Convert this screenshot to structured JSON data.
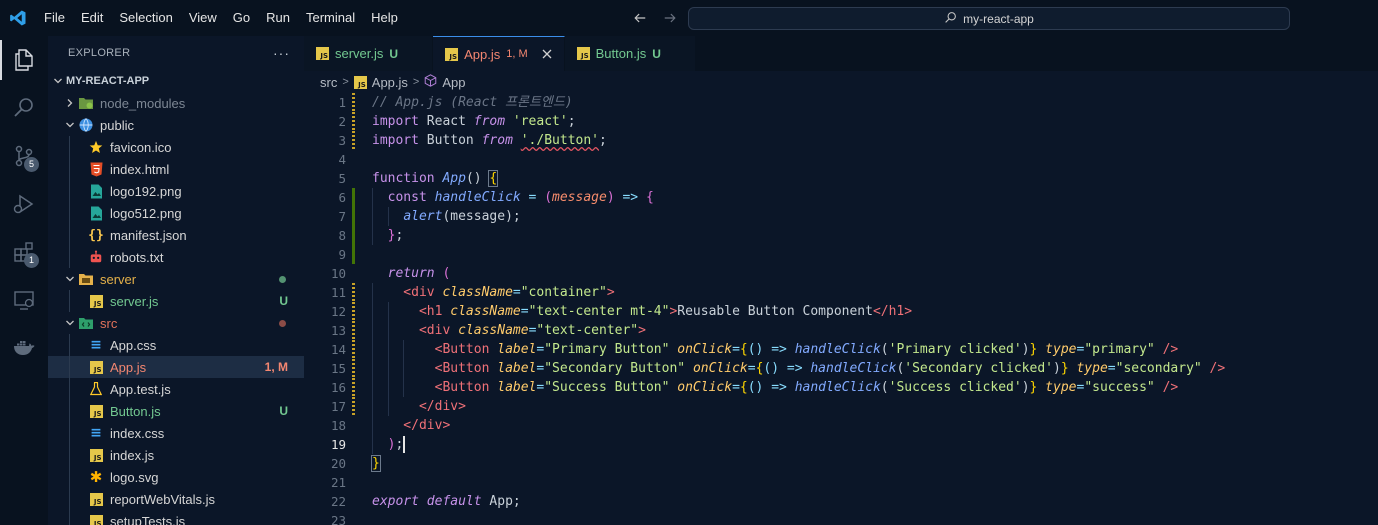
{
  "menu": [
    "File",
    "Edit",
    "Selection",
    "View",
    "Go",
    "Run",
    "Terminal",
    "Help"
  ],
  "search": {
    "label": "my-react-app"
  },
  "activity": {
    "scm_badge": "5",
    "extensions_badge": "1"
  },
  "explorer": {
    "title": "EXPLORER",
    "more": "···",
    "project": "MY-REACT-APP",
    "items": [
      {
        "label": "node_modules",
        "status": ""
      },
      {
        "label": "public",
        "status": ""
      },
      {
        "label": "favicon.ico",
        "status": ""
      },
      {
        "label": "index.html",
        "status": ""
      },
      {
        "label": "logo192.png",
        "status": ""
      },
      {
        "label": "logo512.png",
        "status": ""
      },
      {
        "label": "manifest.json",
        "status": ""
      },
      {
        "label": "robots.txt",
        "status": ""
      },
      {
        "label": "server",
        "status": ""
      },
      {
        "label": "server.js",
        "status": "U"
      },
      {
        "label": "src",
        "status": ""
      },
      {
        "label": "App.css",
        "status": ""
      },
      {
        "label": "App.js",
        "status": "1, M"
      },
      {
        "label": "App.test.js",
        "status": ""
      },
      {
        "label": "Button.js",
        "status": "U"
      },
      {
        "label": "index.css",
        "status": ""
      },
      {
        "label": "index.js",
        "status": ""
      },
      {
        "label": "logo.svg",
        "status": ""
      },
      {
        "label": "reportWebVitals.js",
        "status": ""
      },
      {
        "label": "setupTests.js",
        "status": ""
      }
    ]
  },
  "tabs": [
    {
      "label": "server.js",
      "status": "U"
    },
    {
      "label": "App.js",
      "status": "1, M"
    },
    {
      "label": "Button.js",
      "status": "U"
    }
  ],
  "breadcrumb": [
    "src",
    "App.js",
    "App"
  ],
  "editor": {
    "line_numbers": [
      "1",
      "2",
      "3",
      "4",
      "5",
      "6",
      "7",
      "8",
      "9",
      "10",
      "11",
      "12",
      "13",
      "14",
      "15",
      "16",
      "17",
      "18",
      "19",
      "20",
      "21",
      "22",
      "23"
    ],
    "current_line": 19,
    "lines": [
      [
        [
          "// App.js (React 프론트엔드)",
          "com"
        ]
      ],
      [
        [
          "import",
          "kw2"
        ],
        [
          " React ",
          "plain"
        ],
        [
          "from",
          "kw"
        ],
        [
          " ",
          "plain"
        ],
        [
          "'react'",
          "str"
        ],
        [
          ";",
          "plain"
        ]
      ],
      [
        [
          "import",
          "kw2"
        ],
        [
          " Button ",
          "plain"
        ],
        [
          "from",
          "kw"
        ],
        [
          " ",
          "plain"
        ],
        [
          "'./Button'",
          "str sq"
        ],
        [
          ";",
          "plain"
        ]
      ],
      [],
      [
        [
          "function",
          "kw2"
        ],
        [
          " ",
          "plain"
        ],
        [
          "App",
          "fn"
        ],
        [
          "() ",
          "plain"
        ],
        [
          "{",
          "brace box"
        ]
      ],
      [
        [
          "  const ",
          "kw2"
        ],
        [
          "handleClick",
          "fn"
        ],
        [
          " = ",
          "op"
        ],
        [
          "(",
          "brace2"
        ],
        [
          "message",
          "param"
        ],
        [
          ")",
          "brace2"
        ],
        [
          " => ",
          "op"
        ],
        [
          "{",
          "brace2"
        ]
      ],
      [
        [
          "    ",
          "plain"
        ],
        [
          "alert",
          "fn"
        ],
        [
          "(message);",
          "plain"
        ]
      ],
      [
        [
          "  ",
          "plain"
        ],
        [
          "}",
          "brace2"
        ],
        [
          ";",
          "plain"
        ]
      ],
      [],
      [
        [
          "  return",
          "kw"
        ],
        [
          " ",
          "plain"
        ],
        [
          "(",
          "brace2"
        ]
      ],
      [
        [
          "    <",
          "tag"
        ],
        [
          "div",
          "tag"
        ],
        [
          " ",
          "plain"
        ],
        [
          "className",
          "attr"
        ],
        [
          "=",
          "op"
        ],
        [
          "\"container\"",
          "str"
        ],
        [
          ">",
          "tag"
        ]
      ],
      [
        [
          "      <",
          "tag"
        ],
        [
          "h1",
          "tag"
        ],
        [
          " ",
          "plain"
        ],
        [
          "className",
          "attr"
        ],
        [
          "=",
          "op"
        ],
        [
          "\"text-center mt-4\"",
          "str"
        ],
        [
          ">",
          "tag"
        ],
        [
          "Reusable Button Component",
          "plain"
        ],
        [
          "</",
          "tag"
        ],
        [
          "h1",
          "tag"
        ],
        [
          ">",
          "tag"
        ]
      ],
      [
        [
          "      <",
          "tag"
        ],
        [
          "div",
          "tag"
        ],
        [
          " ",
          "plain"
        ],
        [
          "className",
          "attr"
        ],
        [
          "=",
          "op"
        ],
        [
          "\"text-center\"",
          "str"
        ],
        [
          ">",
          "tag"
        ]
      ],
      [
        [
          "        <",
          "tag"
        ],
        [
          "Button",
          "tag"
        ],
        [
          " ",
          "plain"
        ],
        [
          "label",
          "attr"
        ],
        [
          "=",
          "op"
        ],
        [
          "\"Primary Button\"",
          "str"
        ],
        [
          " ",
          "plain"
        ],
        [
          "onClick",
          "attr"
        ],
        [
          "=",
          "op"
        ],
        [
          "{",
          "brace"
        ],
        [
          "() => ",
          "op"
        ],
        [
          "handleClick",
          "fn"
        ],
        [
          "(",
          "plain"
        ],
        [
          "'Primary clicked'",
          "str"
        ],
        [
          ")",
          "plain"
        ],
        [
          "}",
          "brace"
        ],
        [
          " ",
          "plain"
        ],
        [
          "type",
          "attr"
        ],
        [
          "=",
          "op"
        ],
        [
          "\"primary\"",
          "str"
        ],
        [
          " />",
          "tag"
        ]
      ],
      [
        [
          "        <",
          "tag"
        ],
        [
          "Button",
          "tag"
        ],
        [
          " ",
          "plain"
        ],
        [
          "label",
          "attr"
        ],
        [
          "=",
          "op"
        ],
        [
          "\"Secondary Button\"",
          "str"
        ],
        [
          " ",
          "plain"
        ],
        [
          "onClick",
          "attr"
        ],
        [
          "=",
          "op"
        ],
        [
          "{",
          "brace"
        ],
        [
          "() => ",
          "op"
        ],
        [
          "handleClick",
          "fn"
        ],
        [
          "(",
          "plain"
        ],
        [
          "'Secondary clicked'",
          "str"
        ],
        [
          ")",
          "plain"
        ],
        [
          "}",
          "brace"
        ],
        [
          " ",
          "plain"
        ],
        [
          "type",
          "attr"
        ],
        [
          "=",
          "op"
        ],
        [
          "\"secondary\"",
          "str"
        ],
        [
          " />",
          "tag"
        ]
      ],
      [
        [
          "        <",
          "tag"
        ],
        [
          "Button",
          "tag"
        ],
        [
          " ",
          "plain"
        ],
        [
          "label",
          "attr"
        ],
        [
          "=",
          "op"
        ],
        [
          "\"Success Button\"",
          "str"
        ],
        [
          " ",
          "plain"
        ],
        [
          "onClick",
          "attr"
        ],
        [
          "=",
          "op"
        ],
        [
          "{",
          "brace"
        ],
        [
          "() => ",
          "op"
        ],
        [
          "handleClick",
          "fn"
        ],
        [
          "(",
          "plain"
        ],
        [
          "'Success clicked'",
          "str"
        ],
        [
          ")",
          "plain"
        ],
        [
          "}",
          "brace"
        ],
        [
          " ",
          "plain"
        ],
        [
          "type",
          "attr"
        ],
        [
          "=",
          "op"
        ],
        [
          "\"success\"",
          "str"
        ],
        [
          " />",
          "tag"
        ]
      ],
      [
        [
          "      </",
          "tag"
        ],
        [
          "div",
          "tag"
        ],
        [
          ">",
          "tag"
        ]
      ],
      [
        [
          "    </",
          "tag"
        ],
        [
          "div",
          "tag"
        ],
        [
          ">",
          "tag"
        ]
      ],
      [
        [
          "  ",
          "plain"
        ],
        [
          ")",
          "brace2"
        ],
        [
          ";",
          "plain"
        ],
        [
          "",
          "cursor"
        ]
      ],
      [
        [
          "}",
          "brace box"
        ]
      ],
      [],
      [
        [
          "export",
          "kw"
        ],
        [
          " ",
          "plain"
        ],
        [
          "default",
          "kw"
        ],
        [
          " App;",
          "plain"
        ]
      ],
      []
    ]
  },
  "colors": {
    "accent": "#3b8eea",
    "untracked": "#73c991",
    "modified": "#e2c08d",
    "error": "#f48771",
    "folder_src": "#e2725b",
    "folder_server": "#e5b14a"
  }
}
